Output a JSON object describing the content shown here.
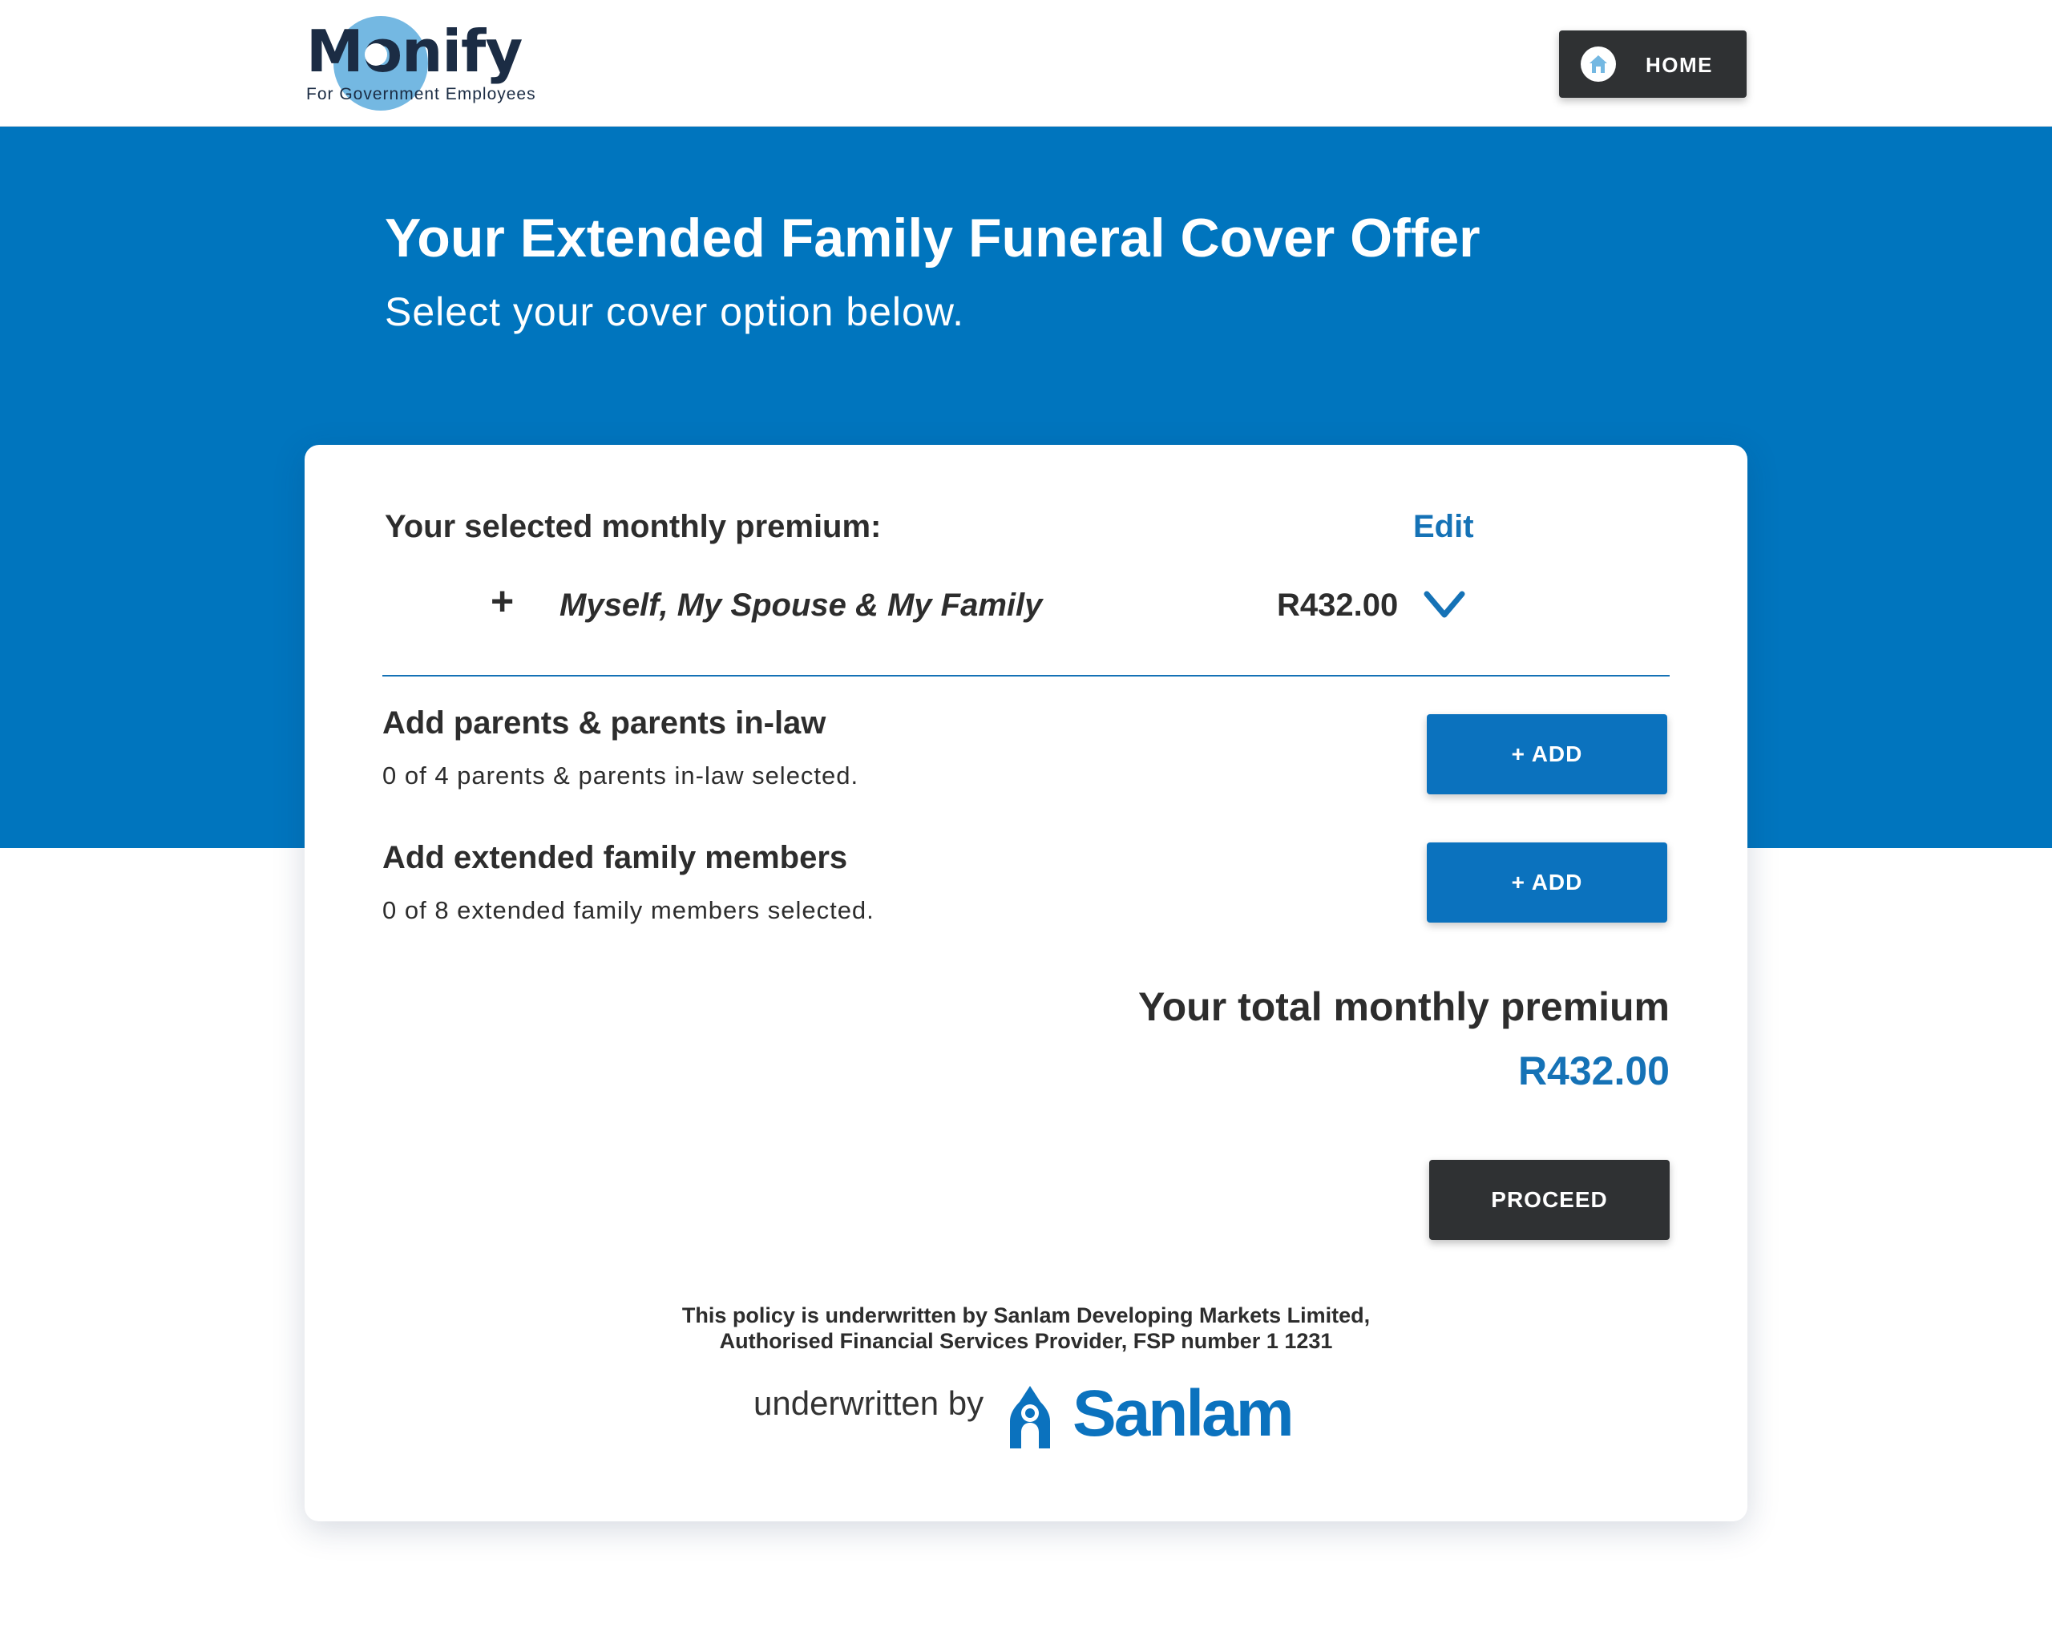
{
  "header": {
    "logo_text": "Monify",
    "logo_tagline": "For Government Employees",
    "home_button_label": "HOME",
    "home_icon": "home-icon"
  },
  "hero": {
    "title": "Your Extended Family Funeral Cover Offer",
    "subtitle": "Select your cover option below."
  },
  "card": {
    "selected_label": "Your selected monthly premium:",
    "edit_label": "Edit",
    "selected_option": {
      "expand_symbol": "+",
      "name": "Myself, My Spouse & My Family",
      "price": "R432.00",
      "toggle_icon": "chevron-down-icon"
    },
    "add_rows": [
      {
        "title": "Add parents & parents in-law",
        "note": "0 of 4 parents & parents in-law selected.",
        "button_label": "+ ADD"
      },
      {
        "title": "Add extended family members",
        "note": "0 of 8 extended family members selected.",
        "button_label": "+ ADD"
      }
    ],
    "total_label": "Your total monthly premium",
    "total_value": "R432.00",
    "proceed_label": "PROCEED",
    "disclaimer_line1": "This policy is underwritten by Sanlam Developing Markets Limited,",
    "disclaimer_line2": "Authorised Financial Services Provider, FSP number 1 1231",
    "underwritten_by": "underwritten by",
    "underwriter_name": "Sanlam"
  },
  "colors": {
    "brand_blue": "#0075be",
    "accent_blue": "#1572b6",
    "button_dark": "#2f3133",
    "logo_circle": "#74b8e2"
  }
}
